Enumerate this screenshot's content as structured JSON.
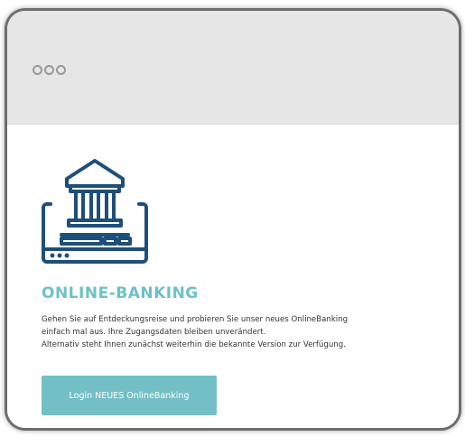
{
  "window": {
    "controls": [
      "dot",
      "dot",
      "dot"
    ]
  },
  "icon": {
    "name": "bank-laptop-icon",
    "color": "#1e4f7a"
  },
  "main": {
    "heading": "ONLINE-BANKING",
    "line1": "Gehen Sie auf Entdeckungsreise und probieren Sie unser neues OnlineBanking",
    "line2": "einfach mal aus. Ihre Zugangsdaten bleiben unverändert.",
    "line3": "Alternativ steht Ihnen zunächst weiterhin die bekannte Version zur Verfügung.",
    "button_label": "Login NEUES OnlineBanking"
  },
  "colors": {
    "accent": "#72c0c6",
    "heading": "#6fc0c8",
    "icon": "#1e4f7a",
    "titlebar": "#e6e6e6"
  }
}
